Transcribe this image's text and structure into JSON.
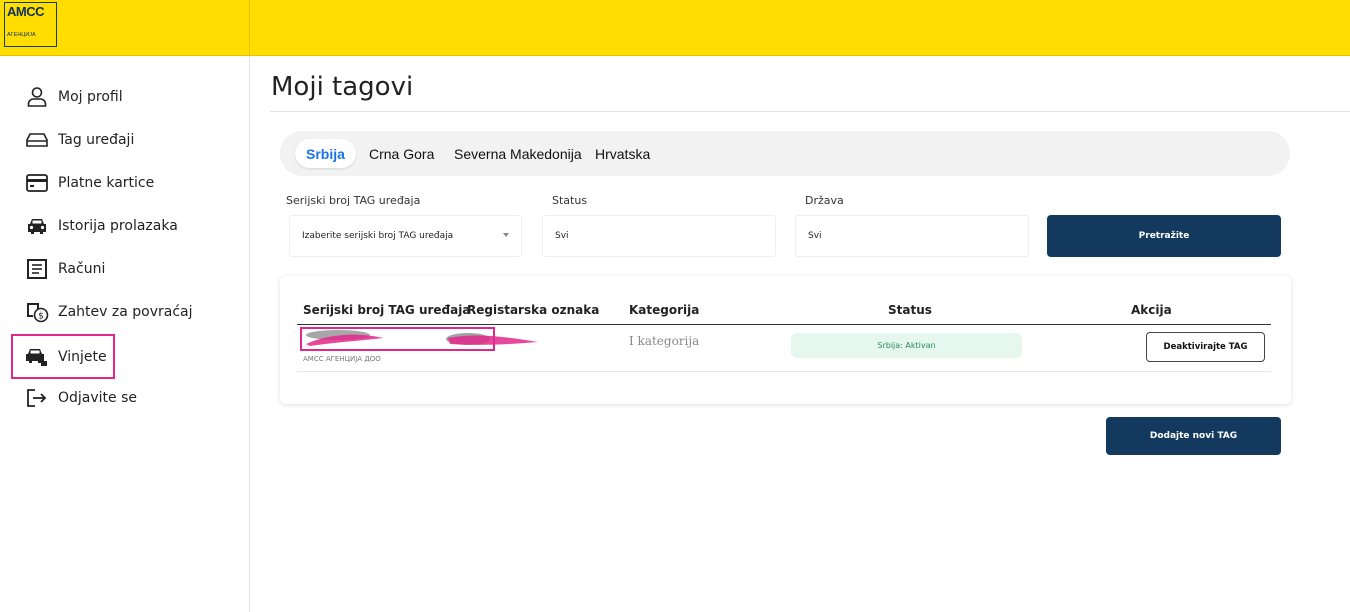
{
  "brand": {
    "logo_text": "AMCC",
    "logo_subtext": "АГЕНЦИЈА"
  },
  "sidebar": {
    "items": [
      {
        "label": "Moj profil",
        "icon": "user-icon"
      },
      {
        "label": "Tag uređaji",
        "icon": "tag-device-icon"
      },
      {
        "label": "Platne kartice",
        "icon": "credit-card-icon"
      },
      {
        "label": "Istorija prolazaka",
        "icon": "car-icon"
      },
      {
        "label": "Računi",
        "icon": "invoice-icon"
      },
      {
        "label": "Zahtev za povraćaj",
        "icon": "refund-icon"
      },
      {
        "label": "Vinjete",
        "icon": "vignette-icon",
        "highlighted": true
      },
      {
        "label": "Odjavite se",
        "icon": "logout-icon"
      }
    ]
  },
  "page": {
    "title": "Moji tagovi"
  },
  "tabs": [
    {
      "label": "Srbija",
      "active": true
    },
    {
      "label": "Crna Gora",
      "active": false
    },
    {
      "label": "Severna Makedonija",
      "active": false
    },
    {
      "label": "Hrvatska",
      "active": false
    }
  ],
  "filters": {
    "serial": {
      "label": "Serijski broj TAG uređaja",
      "value": "Izaberite serijski broj TAG uređaja"
    },
    "status": {
      "label": "Status",
      "value": "Svi"
    },
    "country": {
      "label": "Država",
      "value": "Svi"
    },
    "search_button": "Pretražite"
  },
  "table": {
    "headers": [
      "Serijski broj TAG uređaja",
      "Registarska oznaka",
      "Kategorija",
      "Status",
      "Akcija"
    ],
    "rows": [
      {
        "owner": "AMCC АГЕНЦИЈА ДОО",
        "category": "I kategorija",
        "status": "Srbija: Aktivan",
        "action": "Deaktivirajte TAG"
      }
    ]
  },
  "add_button": "Dodajte novi TAG",
  "colors": {
    "header_yellow": "#ffdd00",
    "primary_navy": "#13395f",
    "accent_blue": "#1a73e8",
    "highlight_pink": "#e0288c",
    "status_green": "#2e8b57"
  }
}
